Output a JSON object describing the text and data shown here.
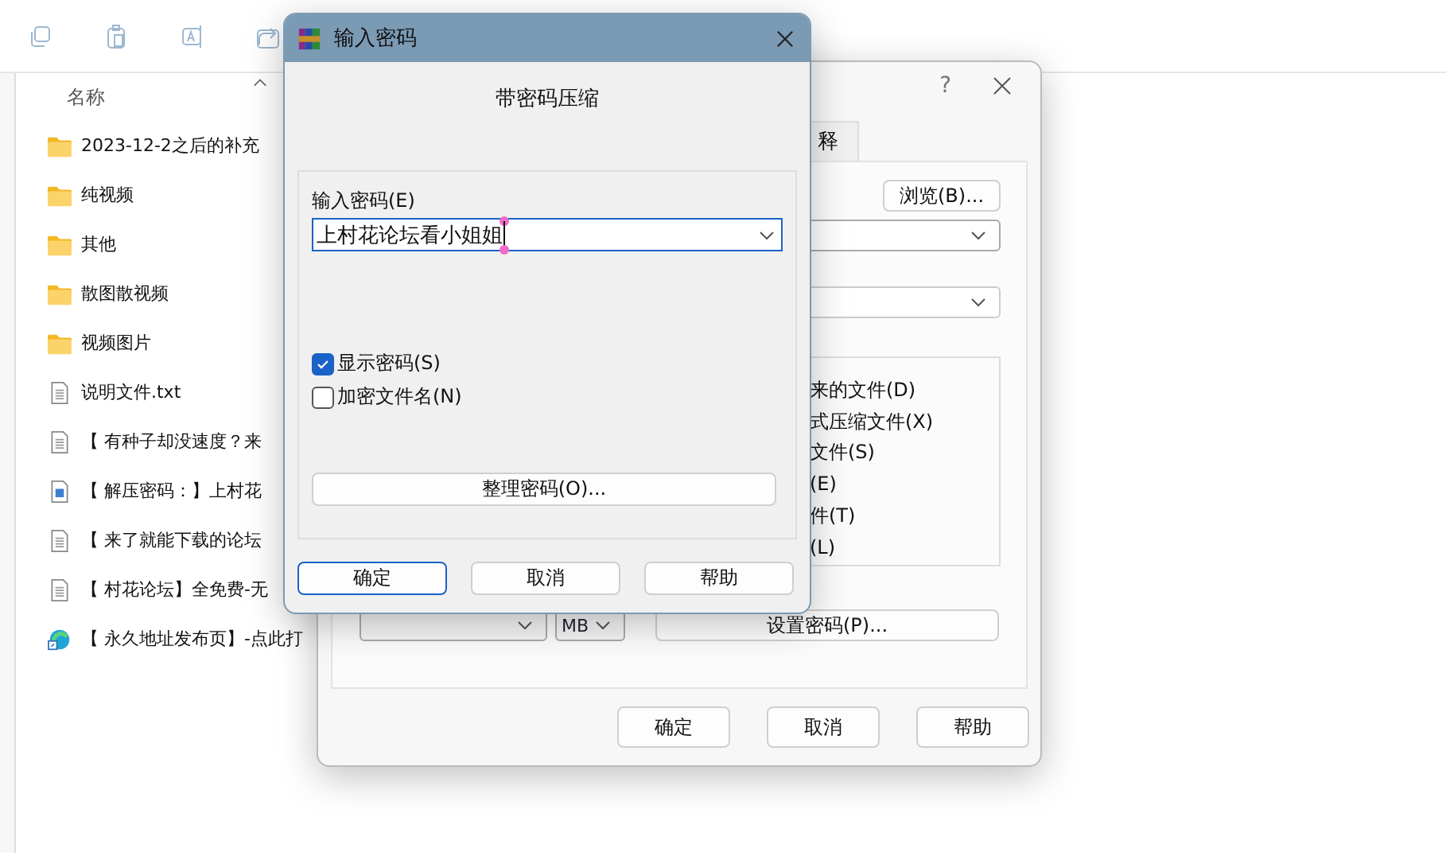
{
  "explorer": {
    "column_header": "名称",
    "files": [
      {
        "name": "2023-12-2之后的补充",
        "kind": "folder"
      },
      {
        "name": "纯视频",
        "kind": "folder"
      },
      {
        "name": "其他",
        "kind": "folder"
      },
      {
        "name": "散图散视频",
        "kind": "folder"
      },
      {
        "name": "视频图片",
        "kind": "folder"
      },
      {
        "name": "说明文件.txt",
        "kind": "text"
      },
      {
        "name": "【 有种子却没速度？来",
        "kind": "text"
      },
      {
        "name": "【 解压密码：】上村花",
        "kind": "image"
      },
      {
        "name": "【 来了就能下载的论坛",
        "kind": "text"
      },
      {
        "name": "【 村花论坛】全免费-无",
        "kind": "text"
      },
      {
        "name": "【 永久地址发布页】-点此打",
        "kind": "link"
      }
    ]
  },
  "back_dialog": {
    "help": "?",
    "tab": "释",
    "browse_button": "浏览(B)...",
    "options": [
      "来的文件(D)",
      "式压缩文件(X)",
      "文件(S)",
      "(E)",
      "件(T)",
      "(L)"
    ],
    "size_unit": "MB",
    "set_password_button": "设置密码(P)...",
    "buttons": [
      "确定",
      "取消",
      "帮助"
    ]
  },
  "password_dialog": {
    "title": "输入密码",
    "heading": "带密码压缩",
    "password_label": "输入密码(E)",
    "password_value": "上村花论坛看小姐姐",
    "checkboxes": [
      {
        "label": "显示密码(S)",
        "checked": true
      },
      {
        "label": "加密文件名(N)",
        "checked": false
      }
    ],
    "organize_button": "整理密码(O)...",
    "buttons": [
      {
        "label": "确定",
        "default": true
      },
      {
        "label": "取消",
        "default": false
      },
      {
        "label": "帮助",
        "default": false
      }
    ]
  }
}
